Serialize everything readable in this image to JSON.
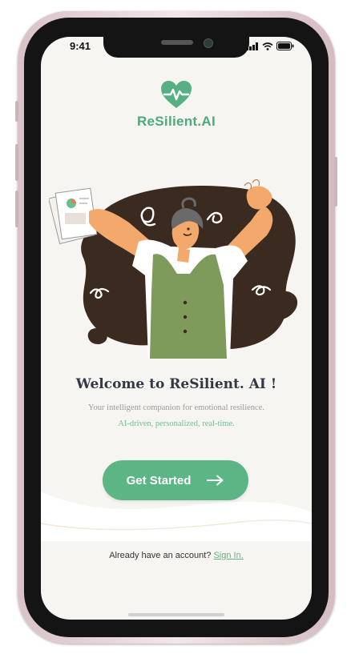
{
  "status_bar": {
    "time": "9:41"
  },
  "brand": {
    "name": "ReSilient.AI",
    "accent": "#5bb585"
  },
  "welcome": {
    "headline": "Welcome to ReSilient. AI !",
    "subtitle": "Your intelligent companion for emotional resilience.",
    "tagline": "AI-driven, personalized, real-time."
  },
  "cta": {
    "label": "Get Started",
    "icon": "arrow-right-icon"
  },
  "signin": {
    "prompt": "Already have an account?",
    "link": "Sign In."
  },
  "illustration": {
    "name": "person-stretching-illustration"
  }
}
